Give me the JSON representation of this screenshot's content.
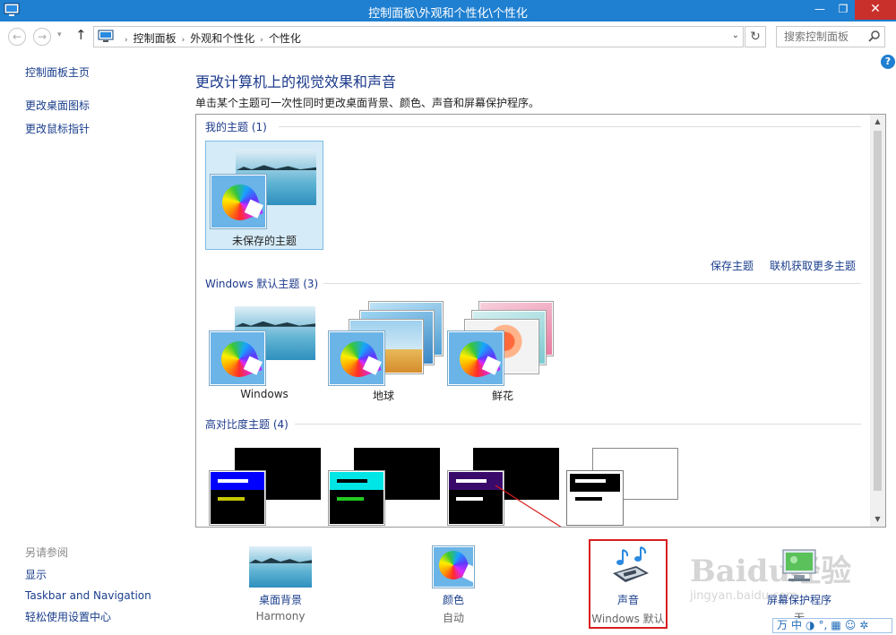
{
  "window": {
    "title": "控制面板\\外观和个性化\\个性化",
    "min_glyph": "—",
    "max_glyph": "❐",
    "close_glyph": "✕"
  },
  "nav": {
    "back_glyph": "←",
    "forward_glyph": "→",
    "recent_glyph": "▾",
    "up_glyph": "↑",
    "refresh_glyph": "↻",
    "dropdown_glyph": "⌄"
  },
  "address": {
    "crumbs": [
      "控制面板",
      "外观和个性化",
      "个性化"
    ],
    "separator": "›"
  },
  "search": {
    "placeholder": "搜索控制面板"
  },
  "help_glyph": "?",
  "sidebar": {
    "items": [
      "控制面板主页",
      "更改桌面图标",
      "更改鼠标指针"
    ]
  },
  "main": {
    "heading": "更改计算机上的视觉效果和声音",
    "subheading": "单击某个主题可一次性同时更改桌面背景、颜色、声音和屏幕保护程序。"
  },
  "themes": {
    "my_themes_header": "我的主题 (1)",
    "unsaved_theme": "未保存的主题",
    "save_theme": "保存主题",
    "get_more": "联机获取更多主题",
    "windows_header": "Windows 默认主题 (3)",
    "windows_themes": [
      "Windows",
      "地球",
      "鲜花"
    ],
    "high_contrast_header": "高对比度主题 (4)",
    "scroll_up": "▲",
    "scroll_down": "▼"
  },
  "see_also": {
    "header": "另请参阅",
    "items": [
      "显示",
      "Taskbar and Navigation",
      "轻松使用设置中心"
    ]
  },
  "tiles": [
    {
      "name": "桌面背景",
      "value": "Harmony"
    },
    {
      "name": "颜色",
      "value": "自动"
    },
    {
      "name": "声音",
      "value": "Windows 默认"
    },
    {
      "name": "屏幕保护程序",
      "value": "无"
    }
  ],
  "ime": {
    "items": [
      "万",
      "中",
      "◑",
      "°,",
      "▦",
      "☺",
      "✲"
    ]
  },
  "watermark": {
    "main": "Baidu经验",
    "sub": "jingyan.baidu.com"
  },
  "colors": {
    "titlebar": "#1f7fd0",
    "link": "#1a3e8c",
    "highlight_box": "#d81e1e",
    "hc_blue": "#0000ff",
    "hc_cyan": "#00e5e5",
    "hc_purple": "#3a0a6b"
  }
}
